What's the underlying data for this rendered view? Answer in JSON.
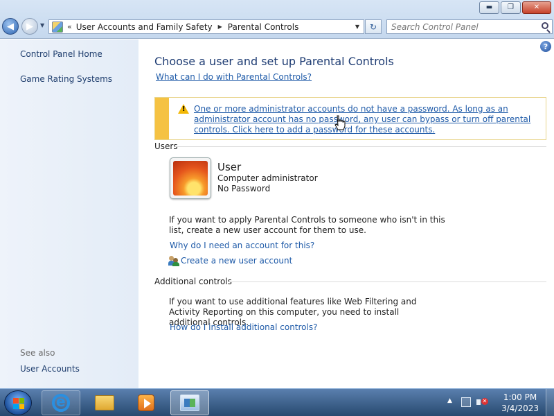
{
  "window": {
    "minimize_glyph": "▬",
    "maximize_glyph": "❐",
    "close_glyph": "✕"
  },
  "addressbar": {
    "overflow_glyph": "«",
    "crumbs": [
      "User Accounts and Family Safety",
      "Parental Controls"
    ]
  },
  "search": {
    "placeholder": "Search Control Panel"
  },
  "leftnav": {
    "home": "Control Panel Home",
    "game_rating": "Game Rating Systems",
    "see_also_heading": "See also",
    "user_accounts": "User Accounts"
  },
  "main": {
    "title": "Choose a user and set up Parental Controls",
    "what_can_i_do_link": "What can I do with Parental Controls?",
    "warning_text": "One or more administrator accounts do not have a password. As long as an administrator account has no password, any user can bypass or turn off parental controls. Click here to add a password for these accounts.",
    "users_heading": "Users",
    "user": {
      "name": "User",
      "role": "Computer administrator",
      "password_status": "No Password"
    },
    "new_account_para": "If you want to apply Parental Controls to someone who isn't in this list, create a new user account for them to use.",
    "why_account_link": "Why do I need an account for this?",
    "create_account_link": "Create a new user account",
    "additional_heading": "Additional controls",
    "additional_para": "If you want to use additional features like Web Filtering and Activity Reporting on this computer, you need to install additional controls.",
    "install_link": "How do I install additional controls?"
  },
  "taskbar": {
    "time": "1:00 PM",
    "date": "3/4/2023"
  },
  "colors": {
    "link": "#1e5aa8",
    "heading": "#1e3c73",
    "warning_bar": "#f5c243",
    "nav_bg": "#e3ecf7"
  }
}
